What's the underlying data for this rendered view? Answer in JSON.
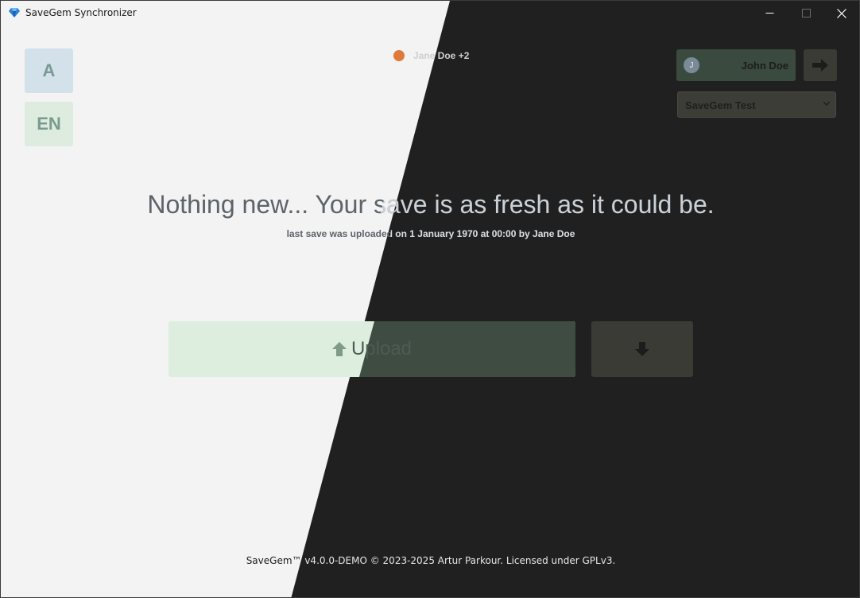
{
  "window": {
    "title": "SaveGem Synchronizer",
    "icon": "gem-icon",
    "controls": {
      "minimize": "minimize-icon",
      "maximize": "maximize-icon",
      "close": "close-icon"
    }
  },
  "sidebar": {
    "theme_label": "A",
    "language_label": "EN"
  },
  "online": {
    "status_color": "#e07a3a",
    "names": "Jane Doe +2"
  },
  "account": {
    "avatar_initial": "J",
    "username": "John Doe",
    "logout_icon": "arrow-right-icon",
    "selected_game": "SaveGem Test",
    "selector_icon": "chevron-down-icon"
  },
  "status": {
    "headline": "Nothing new... Your save is as fresh as it could be.",
    "detail": "last save was uploaded on 1 January 1970 at 00:00 by Jane Doe"
  },
  "actions": {
    "upload_label": "Upload",
    "upload_icon": "arrow-up-icon",
    "download_icon": "arrow-down-icon"
  },
  "footer": {
    "text": "SaveGem™ v4.0.0-DEMO © 2023-2025 Artur Parkour. Licensed under GPLv3."
  },
  "colors": {
    "light_bg": "#f3f3f3",
    "dark_bg": "#202020",
    "accent_orange": "#e07a3a",
    "upload_green": "#ddeedf"
  }
}
